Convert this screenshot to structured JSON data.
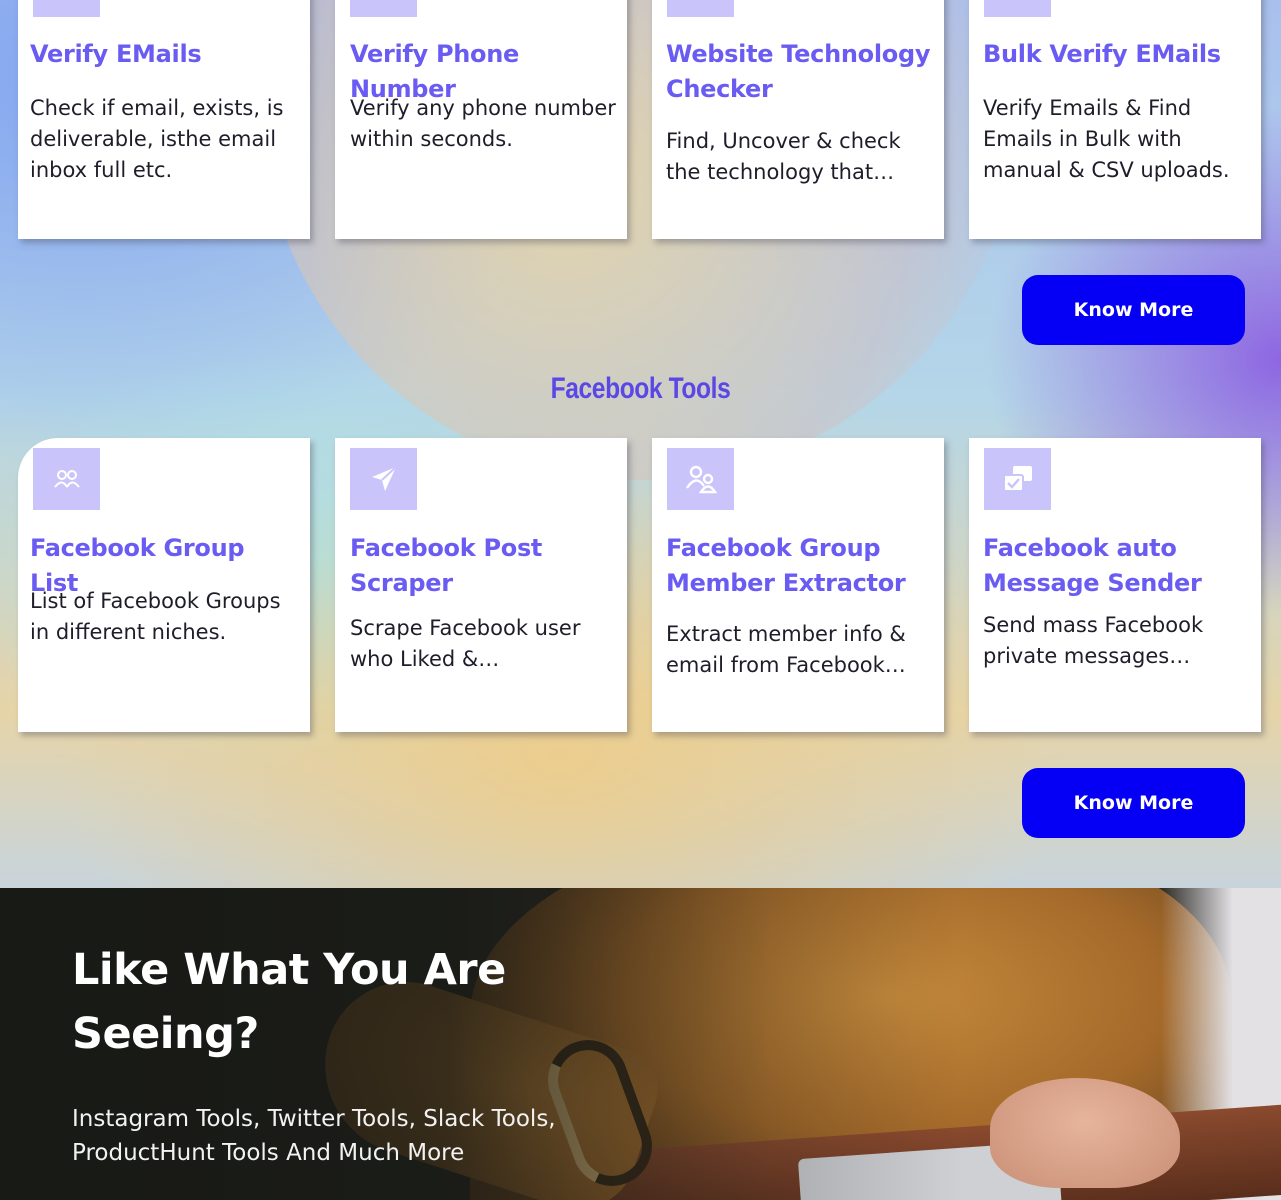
{
  "email_tools": {
    "cards": [
      {
        "title": "Verify EMails",
        "description": "Check if email, exists, is deliverable, isthe email inbox full etc."
      },
      {
        "title": "Verify Phone Number",
        "description": "Verify any phone number within seconds."
      },
      {
        "title": "Website Technology Checker",
        "description": "Find, Uncover & check the technology that run…"
      },
      {
        "title": "Bulk Verify EMails",
        "description": "Verify Emails & Find Emails in Bulk with manual & CSV uploads."
      }
    ],
    "button_label": "Know More"
  },
  "facebook_tools": {
    "heading": "Facebook Tools",
    "cards": [
      {
        "title": "Facebook Group List",
        "description": "List of Facebook Groups in different niches.",
        "icon": "users-icon"
      },
      {
        "title": "Facebook Post Scraper",
        "description": "Scrape Facebook user who Liked & Commente…",
        "icon": "paper-plane-icon"
      },
      {
        "title": "Facebook Group Member Extractor",
        "description": "Extract member info & email from Facebook…",
        "icon": "user-group-icon"
      },
      {
        "title": "Facebook auto Message Sender",
        "description": "Send mass Facebook private messages…",
        "icon": "message-check-icon"
      }
    ],
    "button_label": "Know More"
  },
  "hero": {
    "title": "Like What You Are Seeing?",
    "subtitle": "Instagram Tools, Twitter Tools, Slack Tools, ProductHunt Tools And Much More"
  },
  "colors": {
    "accent": "#6a5cf2",
    "button": "#0500f5",
    "icon_bg": "#c9c5fb"
  }
}
